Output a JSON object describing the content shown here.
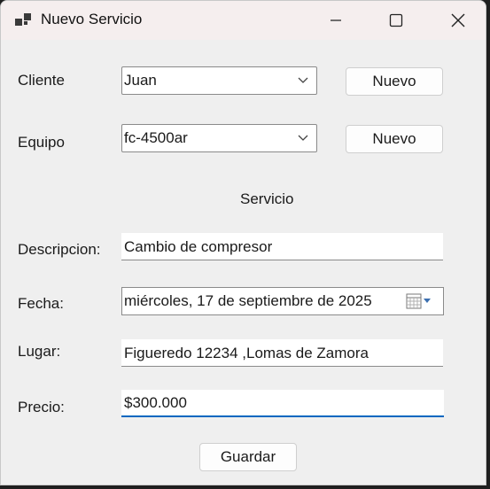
{
  "window": {
    "title": "Nuevo Servicio"
  },
  "labels": {
    "cliente": "Cliente",
    "equipo": "Equipo",
    "servicio": "Servicio",
    "descripcion": "Descripcion:",
    "fecha": "Fecha:",
    "lugar": "Lugar:",
    "precio": "Precio:"
  },
  "fields": {
    "cliente_value": "Juan",
    "equipo_value": "fc-4500ar",
    "descripcion_value": "Cambio de compresor",
    "fecha_value": "miércoles, 17 de septiembre de 2025",
    "lugar_value": "Figueredo 12234 ,Lomas de Zamora",
    "precio_value": "$300.000"
  },
  "buttons": {
    "nuevo_cliente": "Nuevo",
    "nuevo_equipo": "Nuevo",
    "guardar": "Guardar"
  },
  "colors": {
    "accent": "#0067c0",
    "titlebar": "#f5eeee",
    "window_bg": "#efefef"
  }
}
